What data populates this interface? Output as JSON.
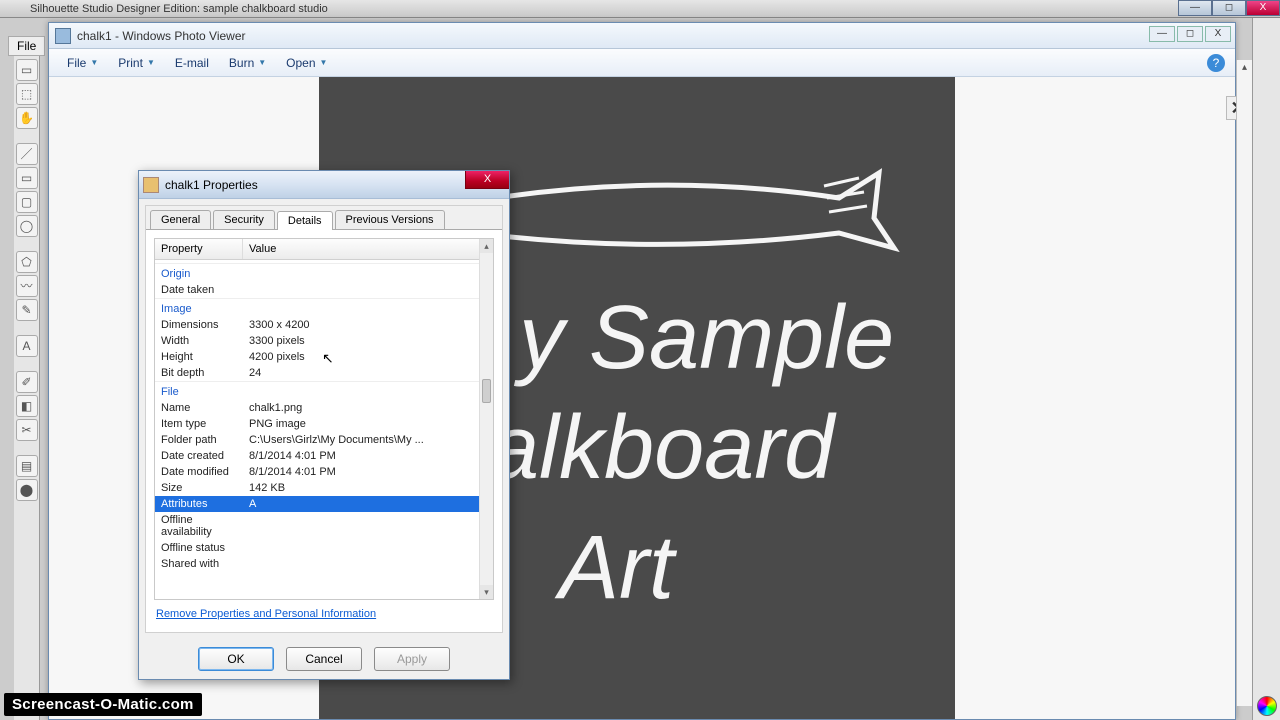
{
  "bgapp_title": "Silhouette Studio Designer Edition: sample chalkboard studio",
  "file_label": "File",
  "photo_viewer": {
    "title": "chalk1 - Windows Photo Viewer",
    "menu": [
      "File",
      "Print",
      "E-mail",
      "Burn",
      "Open"
    ]
  },
  "chalk_art": {
    "line1": "y Sample",
    "line2": "alkboard",
    "line3": "Art"
  },
  "dlg": {
    "title": "chalk1 Properties",
    "tabs": [
      "General",
      "Security",
      "Details",
      "Previous Versions"
    ],
    "active_tab": "Details",
    "hdr_prop": "Property",
    "hdr_val": "Value",
    "sections": {
      "origin": "Origin",
      "image": "Image",
      "file": "File"
    },
    "rows": {
      "date_taken_k": "Date taken",
      "date_taken_v": "",
      "dimensions_k": "Dimensions",
      "dimensions_v": "3300 x 4200",
      "width_k": "Width",
      "width_v": "3300 pixels",
      "height_k": "Height",
      "height_v": "4200 pixels",
      "bitdepth_k": "Bit depth",
      "bitdepth_v": "24",
      "name_k": "Name",
      "name_v": "chalk1.png",
      "itemtype_k": "Item type",
      "itemtype_v": "PNG image",
      "folder_k": "Folder path",
      "folder_v": "C:\\Users\\Girlz\\My Documents\\My ...",
      "created_k": "Date created",
      "created_v": "8/1/2014 4:01 PM",
      "modified_k": "Date modified",
      "modified_v": "8/1/2014 4:01 PM",
      "size_k": "Size",
      "size_v": "142 KB",
      "attr_k": "Attributes",
      "attr_v": "A",
      "offavail_k": "Offline availability",
      "offavail_v": "",
      "offstat_k": "Offline status",
      "offstat_v": "",
      "shared_k": "Shared with"
    },
    "remove_link": "Remove Properties and Personal Information",
    "btn_ok": "OK",
    "btn_cancel": "Cancel",
    "btn_apply": "Apply"
  },
  "brand": "Screencast-O-Matic.com"
}
